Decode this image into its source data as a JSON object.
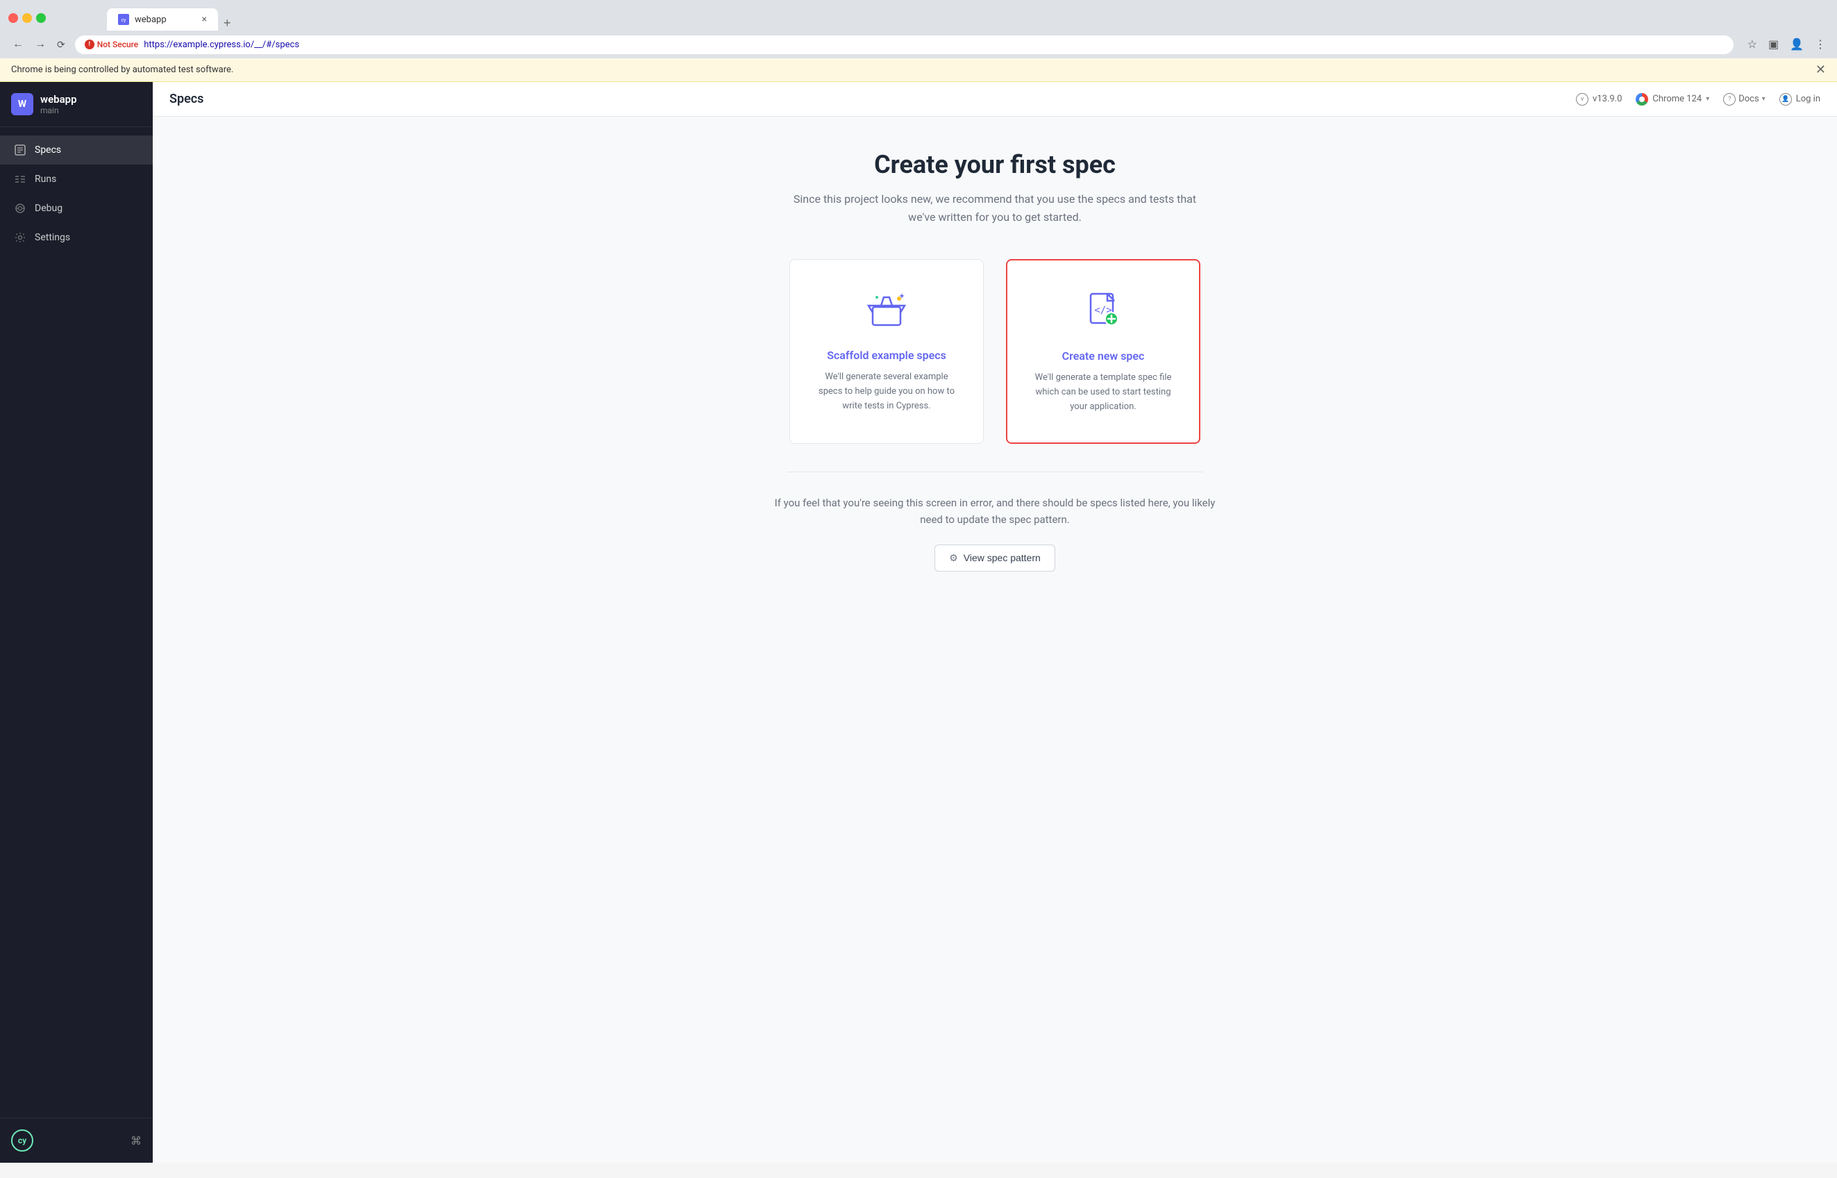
{
  "browser": {
    "tab_title": "webapp",
    "url_not_secure_label": "Not Secure",
    "url": "https://example.cypress.io/__/#/specs",
    "url_display": "https://example.cypress.io/__/#/specs",
    "automation_bar_text": "Chrome is being controlled by automated test software.",
    "close_label": "×",
    "new_tab_label": "+"
  },
  "header": {
    "page_title": "Specs",
    "version_label": "v13.9.0",
    "chrome_label": "Chrome 124",
    "docs_label": "Docs",
    "login_label": "Log in"
  },
  "sidebar": {
    "app_name": "webapp",
    "app_branch": "main",
    "nav_items": [
      {
        "label": "Specs",
        "active": true
      },
      {
        "label": "Runs",
        "active": false
      },
      {
        "label": "Debug",
        "active": false
      },
      {
        "label": "Settings",
        "active": false
      }
    ],
    "keyboard_shortcut": "⌘"
  },
  "main": {
    "hero_title": "Create your first spec",
    "hero_subtitle": "Since this project looks new, we recommend that you use the specs and tests that we've written for you to get started.",
    "cards": [
      {
        "id": "scaffold",
        "title": "Scaffold example specs",
        "description": "We'll generate several example specs to help guide you on how to write tests in Cypress.",
        "selected": false
      },
      {
        "id": "create-new",
        "title": "Create new spec",
        "description": "We'll generate a template spec file which can be used to start testing your application.",
        "selected": true
      }
    ],
    "error_text": "If you feel that you're seeing this screen in error, and there should be specs listed here, you likely need to update the spec pattern.",
    "view_spec_pattern_label": "View spec pattern"
  }
}
